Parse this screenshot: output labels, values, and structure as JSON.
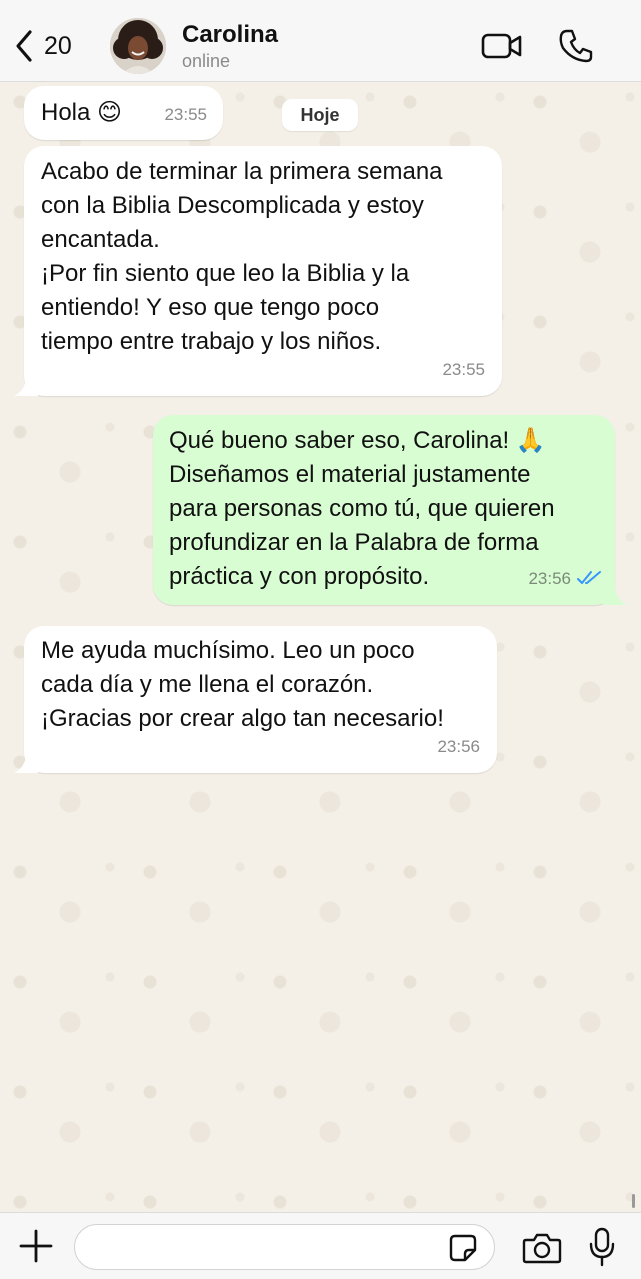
{
  "header": {
    "back_count": "20",
    "contact_name": "Carolina",
    "contact_status": "online"
  },
  "date_chip": "Hoje",
  "messages": [
    {
      "direction": "incoming",
      "text": "Hola 😊",
      "time": "23:55"
    },
    {
      "direction": "incoming",
      "text": "Acabo de terminar la primera semana\ncon la Biblia Descomplicada y estoy\nencantada.\n¡Por fin siento que leo la Biblia y la\nentiendo! Y eso que tengo poco\ntiempo entre trabajo y los niños.",
      "time": "23:55"
    },
    {
      "direction": "outgoing",
      "text": "Qué bueno saber eso, Carolina! 🙏\nDiseñamos el material justamente\npara personas como tú, que quieren\nprofundizar en la Palabra de forma\npráctica y con propósito.",
      "time": "23:56",
      "status": "read"
    },
    {
      "direction": "incoming",
      "text": "Me ayuda muchísimo. Leo un poco\ncada día y me llena el corazón.\n¡Gracias por crear algo tan necesario!",
      "time": "23:56"
    }
  ],
  "input": {
    "value": "",
    "placeholder": ""
  },
  "colors": {
    "incoming_bubble": "#ffffff",
    "outgoing_bubble": "#d9fdd3",
    "read_ticks": "#3497f9",
    "icon": "#111111"
  },
  "icons": {
    "back": "chevron-left-icon",
    "video": "video-camera-icon",
    "call": "phone-icon",
    "plus": "plus-icon",
    "sticker": "sticker-icon",
    "camera": "camera-icon",
    "mic": "microphone-icon"
  }
}
